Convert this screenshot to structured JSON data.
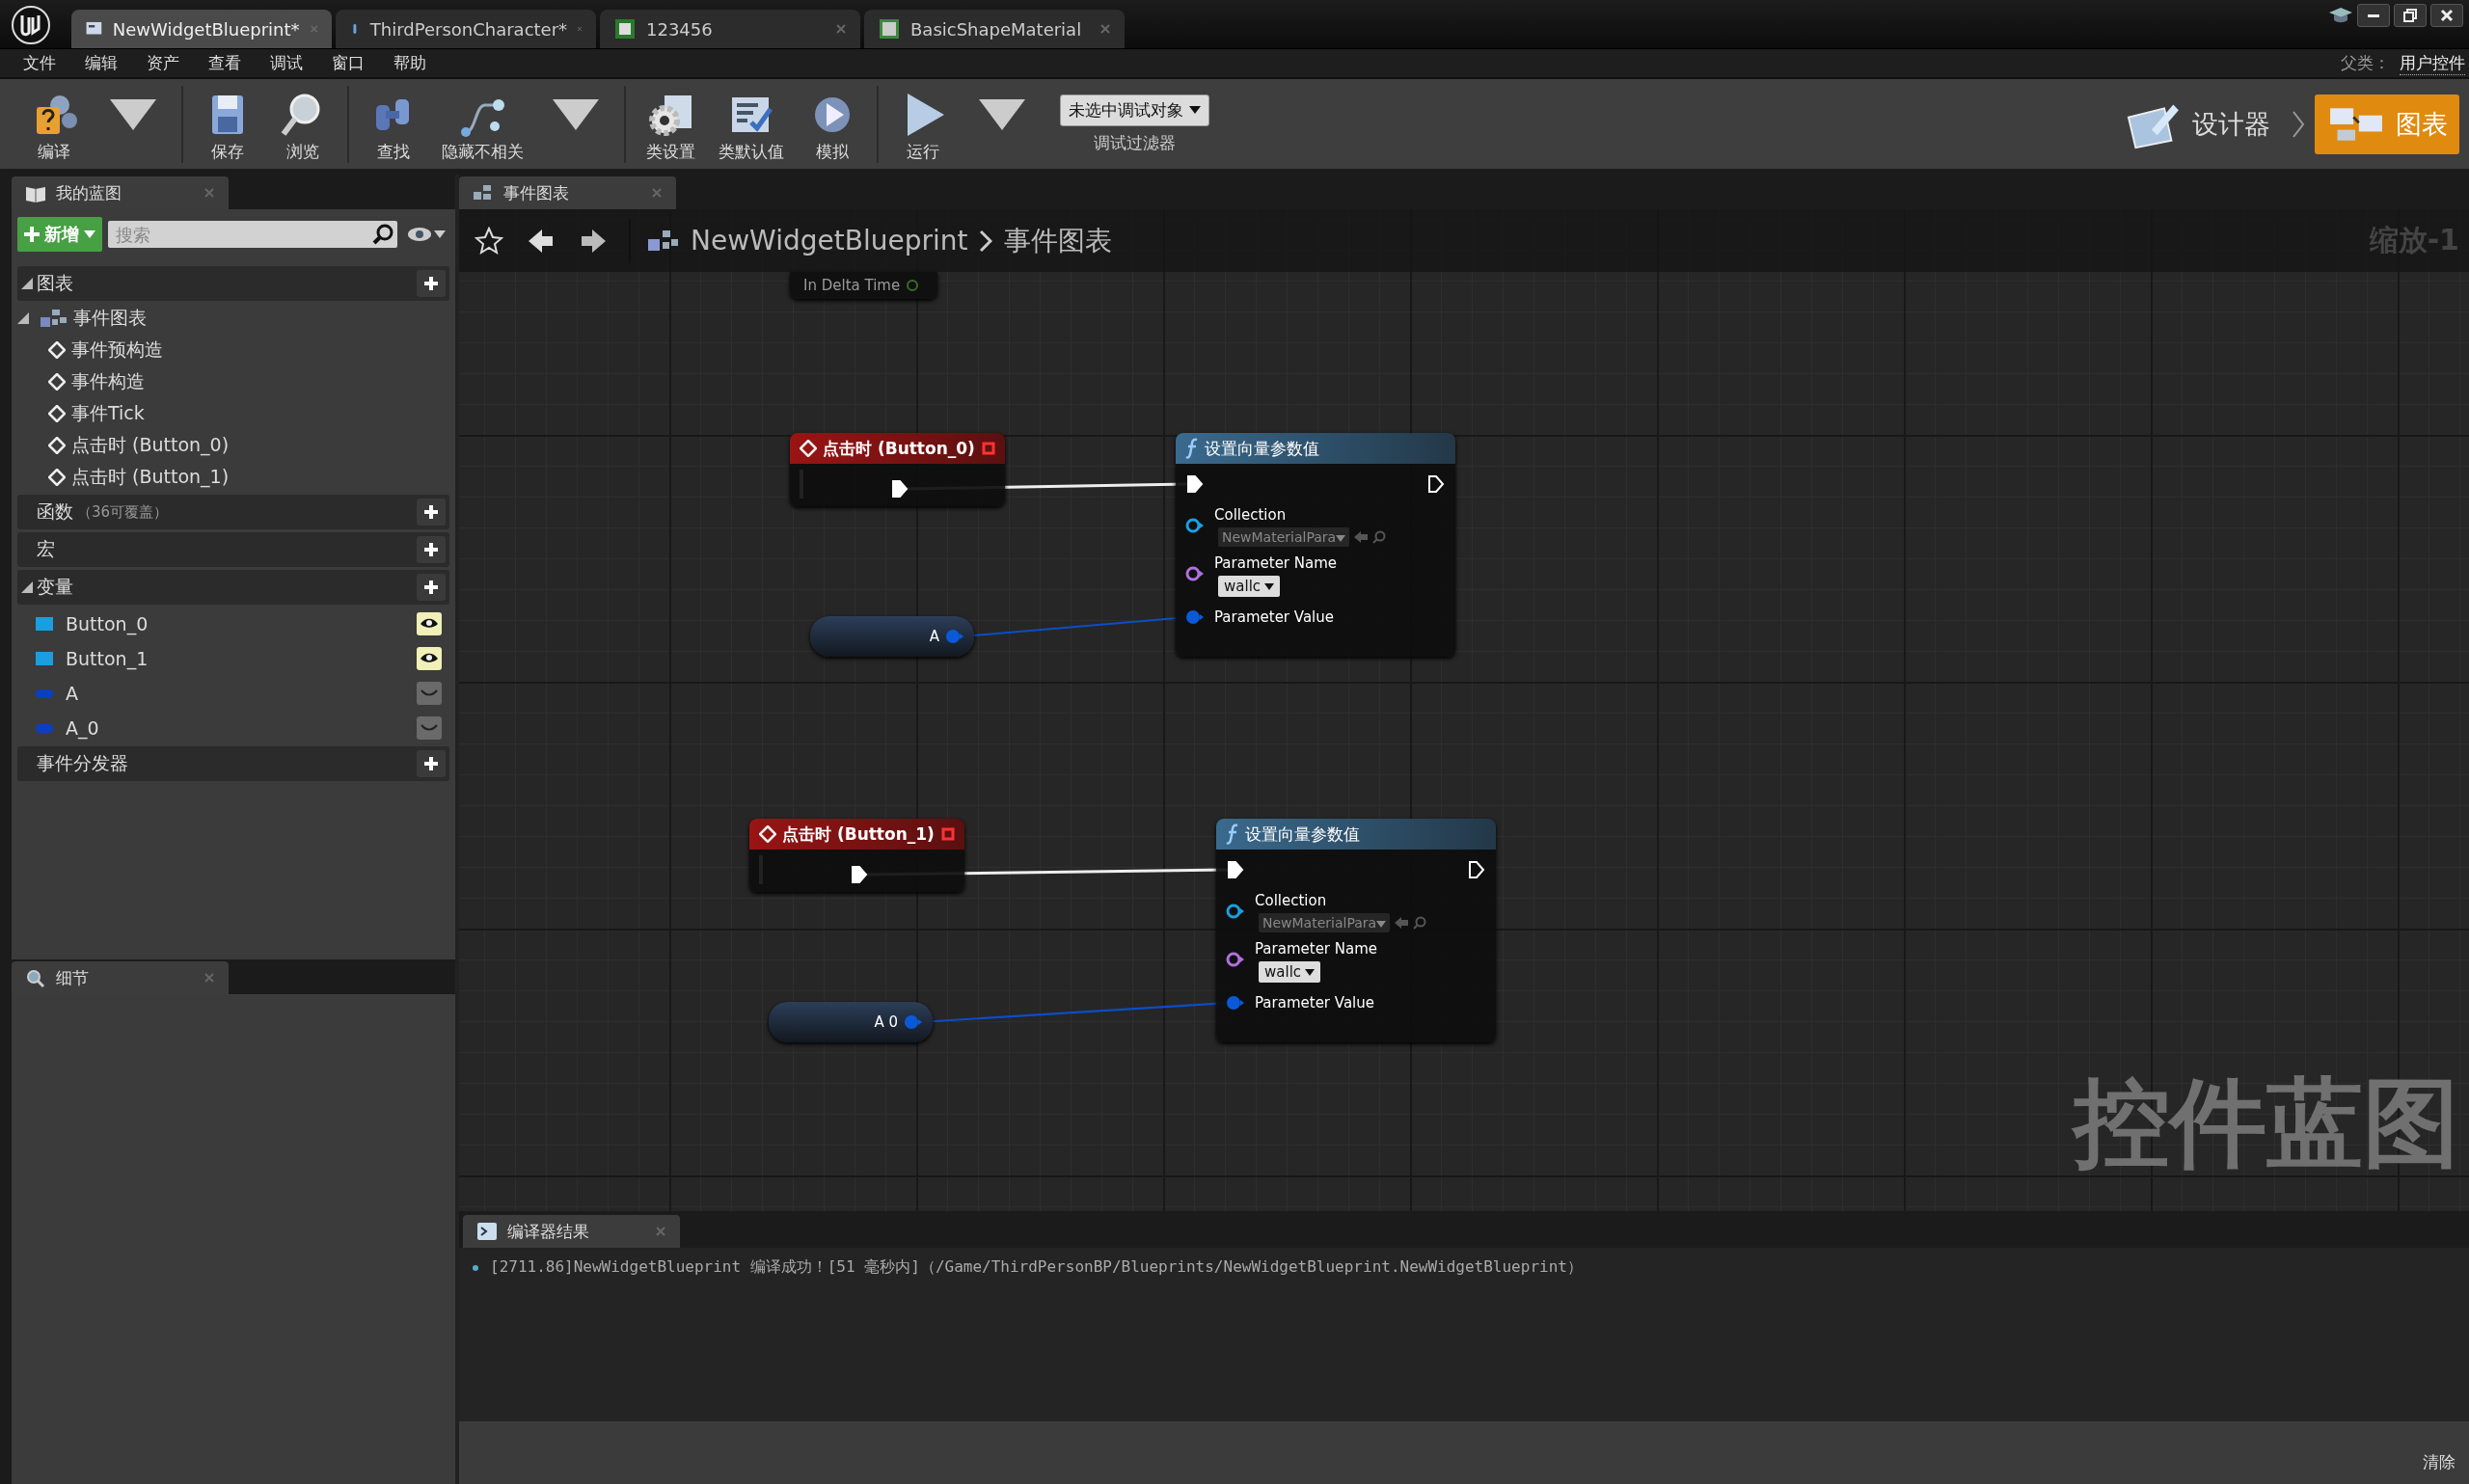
{
  "window_tabs": [
    {
      "label": "NewWidgetBlueprint*",
      "kind": "widget",
      "selected": true
    },
    {
      "label": "ThirdPersonCharacter*",
      "kind": "character",
      "selected": false
    },
    {
      "label": "123456",
      "kind": "asset",
      "selected": false
    },
    {
      "label": "BasicShapeMaterial",
      "kind": "material",
      "selected": false
    }
  ],
  "menu": [
    "文件",
    "编辑",
    "资产",
    "查看",
    "调试",
    "窗口",
    "帮助"
  ],
  "parent_class": {
    "label": "父类：",
    "value": "用户控件"
  },
  "toolbar": {
    "buttons": [
      {
        "label": "编译",
        "kind": "compile",
        "dropdown": true
      },
      {
        "label": "保存",
        "kind": "save",
        "dropdown": false
      },
      {
        "label": "浏览",
        "kind": "browse",
        "dropdown": false
      },
      {
        "label": "查找",
        "kind": "find",
        "dropdown": false
      },
      {
        "label": "隐藏不相关",
        "kind": "hide",
        "dropdown": true
      },
      {
        "label": "类设置",
        "kind": "settings",
        "dropdown": false
      },
      {
        "label": "类默认值",
        "kind": "defaults",
        "dropdown": false
      },
      {
        "label": "模拟",
        "kind": "simulate",
        "dropdown": false
      },
      {
        "label": "运行",
        "kind": "play",
        "dropdown": true
      }
    ],
    "debug_filter": {
      "value": "未选中调试对象",
      "label": "调试过滤器"
    },
    "modes": [
      {
        "label": "设计器",
        "kind": "designer",
        "selected": false
      },
      {
        "label": "图表",
        "kind": "graph",
        "selected": true
      }
    ]
  },
  "my_blueprint": {
    "tab": "我的蓝图",
    "new_button": "新增",
    "search": {
      "placeholder": "搜索"
    },
    "sections": [
      {
        "title": "图表",
        "expanded": true,
        "items": [
          {
            "label": "事件图表",
            "expanded": true,
            "children": [
              {
                "label": "事件预构造"
              },
              {
                "label": "事件构造"
              },
              {
                "label": "事件Tick"
              },
              {
                "label": "点击时 (Button_0)"
              },
              {
                "label": "点击时 (Button_1)"
              }
            ]
          }
        ]
      },
      {
        "title": "函数",
        "note": "（36可覆盖）",
        "expanded": false
      },
      {
        "title": "宏",
        "expanded": false
      },
      {
        "title": "变量",
        "expanded": true,
        "variables": [
          {
            "name": "Button_0",
            "kind": "widget",
            "color": "#1a9ee0",
            "visible": true
          },
          {
            "name": "Button_1",
            "kind": "widget",
            "color": "#1a9ee0",
            "visible": true
          },
          {
            "name": "A",
            "kind": "vector",
            "color": "#0a3fbf",
            "visible": false
          },
          {
            "name": "A_0",
            "kind": "vector",
            "color": "#0a3fbf",
            "visible": false
          }
        ]
      },
      {
        "title": "事件分发器",
        "expanded": false
      }
    ]
  },
  "details": {
    "tab": "细节"
  },
  "graph": {
    "tab": "事件图表",
    "breadcrumb": [
      "NewWidgetBlueprint",
      "事件图表"
    ],
    "zoom": "缩放-1",
    "watermark": "控件蓝图",
    "nodes": [
      {
        "kind": "partial",
        "label": "In Delta Time"
      },
      {
        "kind": "event",
        "title": "点击时 (Button_0)"
      },
      {
        "kind": "function",
        "title": "设置向量参数值",
        "pins": [
          {
            "kind": "object",
            "label": "Collection",
            "value": "NewMaterialPara"
          },
          {
            "kind": "name",
            "label": "Parameter Name",
            "value": "wallc"
          },
          {
            "kind": "struct",
            "label": "Parameter Value"
          }
        ]
      },
      {
        "kind": "variable",
        "label": "A"
      },
      {
        "kind": "event",
        "title": "点击时 (Button_1)"
      },
      {
        "kind": "function",
        "title": "设置向量参数值",
        "pins": [
          {
            "kind": "object",
            "label": "Collection",
            "value": "NewMaterialPara"
          },
          {
            "kind": "name",
            "label": "Parameter Name",
            "value": "wallc"
          },
          {
            "kind": "struct",
            "label": "Parameter Value"
          }
        ]
      },
      {
        "kind": "variable",
        "label": "A 0"
      }
    ]
  },
  "compiler": {
    "tab": "编译器结果",
    "messages": [
      "[2711.86]NewWidgetBlueprint 编译成功！[51 毫秒内]（/Game/ThirdPersonBP/Blueprints/NewWidgetBlueprint.NewWidgetBlueprint）"
    ],
    "clear_button": "清除"
  }
}
